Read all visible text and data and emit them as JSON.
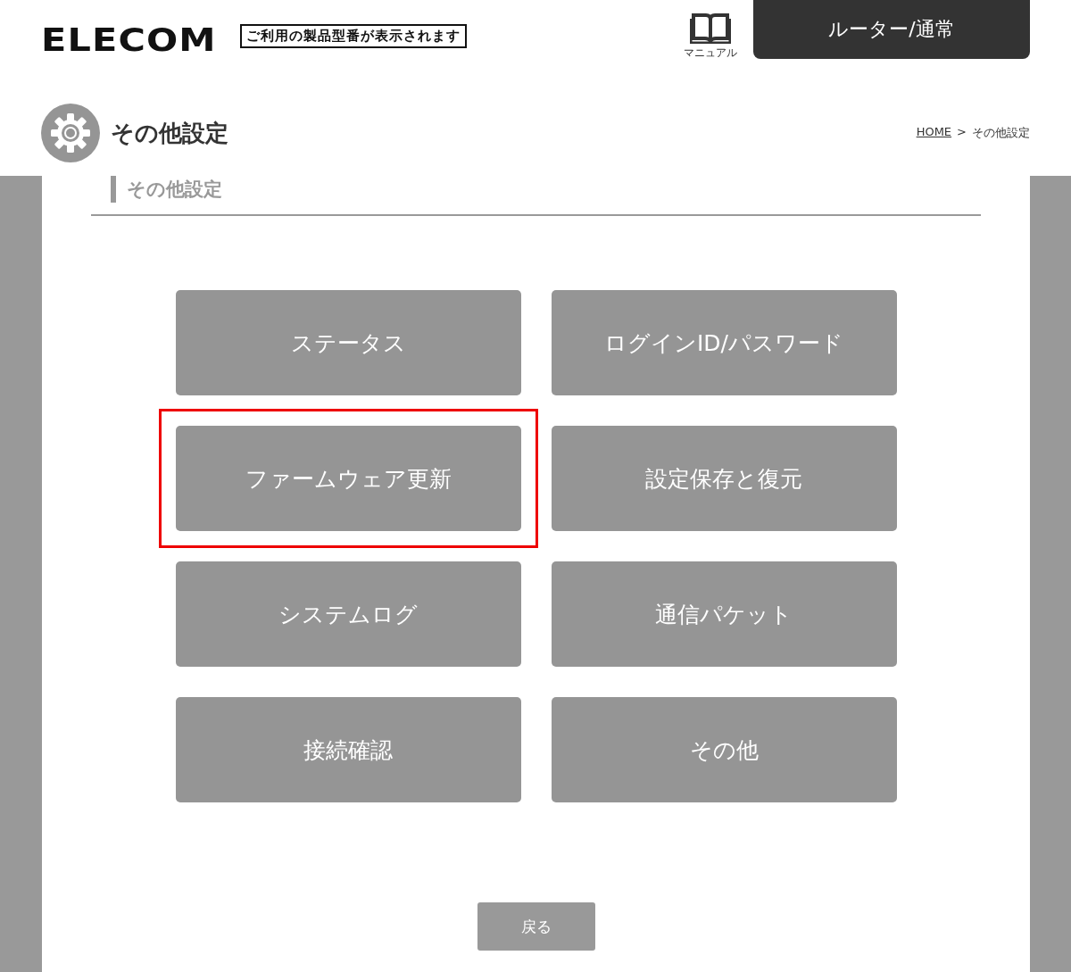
{
  "header": {
    "logo": "ELECOM",
    "model_label": "ご利用の製品型番が表示されます",
    "manual_label": "マニュアル",
    "mode": "ルーター/通常"
  },
  "page": {
    "title": "その他設定",
    "breadcrumb": {
      "home": "HOME",
      "separator": ">",
      "current": "その他設定"
    }
  },
  "section": {
    "title": "その他設定"
  },
  "menu": [
    {
      "label": "ステータス",
      "highlighted": false
    },
    {
      "label": "ログインID/パスワード",
      "highlighted": false
    },
    {
      "label": "ファームウェア更新",
      "highlighted": true
    },
    {
      "label": "設定保存と復元",
      "highlighted": false
    },
    {
      "label": "システムログ",
      "highlighted": false
    },
    {
      "label": "通信パケット",
      "highlighted": false
    },
    {
      "label": "接続確認",
      "highlighted": false
    },
    {
      "label": "その他",
      "highlighted": false
    }
  ],
  "back_button": "戻る"
}
